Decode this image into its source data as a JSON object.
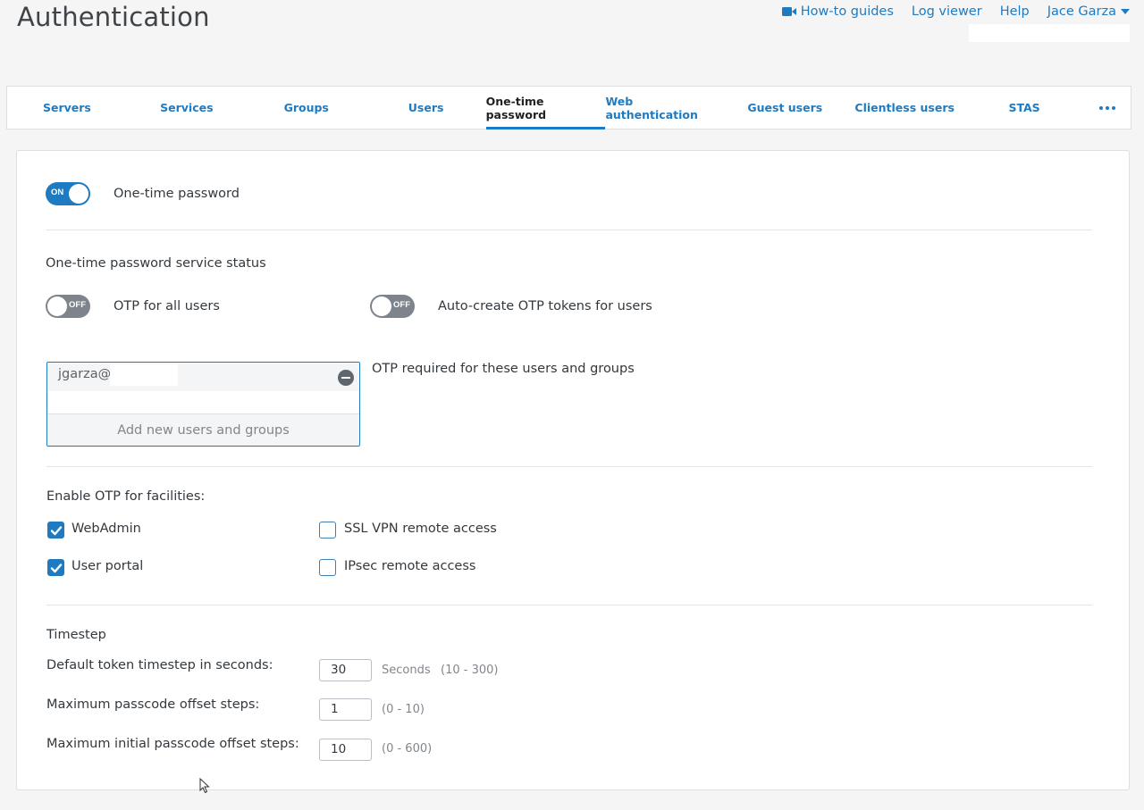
{
  "page_title": "Authentication",
  "topnav": {
    "howto_label": "How-to guides",
    "logviewer_label": "Log viewer",
    "help_label": "Help",
    "user_label": "Jace Garza"
  },
  "tabs": [
    {
      "label": "Servers"
    },
    {
      "label": "Services"
    },
    {
      "label": "Groups"
    },
    {
      "label": "Users"
    },
    {
      "label": "One-time password"
    },
    {
      "label": "Web authentication"
    },
    {
      "label": "Guest users"
    },
    {
      "label": "Clientless users"
    },
    {
      "label": "STAS"
    }
  ],
  "otp_toggle": {
    "state": "ON",
    "label": "One-time password"
  },
  "service_status": {
    "heading": "One-time password service status",
    "all_users": {
      "state": "OFF",
      "label": "OTP for all users"
    },
    "auto_create": {
      "state": "OFF",
      "label": "Auto-create OTP tokens for users"
    }
  },
  "otp_required": {
    "label": "OTP required for these users and groups",
    "entries": [
      {
        "text": "jgarza@"
      }
    ],
    "add_label": "Add new users and groups"
  },
  "facilities": {
    "heading": "Enable OTP for facilities:",
    "webadmin": {
      "label": "WebAdmin",
      "checked": true
    },
    "user_portal": {
      "label": "User portal",
      "checked": true
    },
    "ssl_vpn": {
      "label": "SSL VPN remote access",
      "checked": false
    },
    "ipsec": {
      "label": "IPsec remote access",
      "checked": false
    }
  },
  "timestep": {
    "heading": "Timestep",
    "default_step": {
      "label": "Default token timestep in seconds:",
      "value": "30",
      "unit": "Seconds",
      "range": "(10 - 300)"
    },
    "max_offset": {
      "label": "Maximum passcode offset steps:",
      "value": "1",
      "range": "(0 - 10)"
    },
    "max_initial_offset": {
      "label": "Maximum initial passcode offset steps:",
      "value": "10",
      "range": "(0 - 600)"
    }
  },
  "colors": {
    "accent": "#1f7bc1",
    "toggle_off": "#7d848b",
    "background": "#f5f5f6"
  }
}
